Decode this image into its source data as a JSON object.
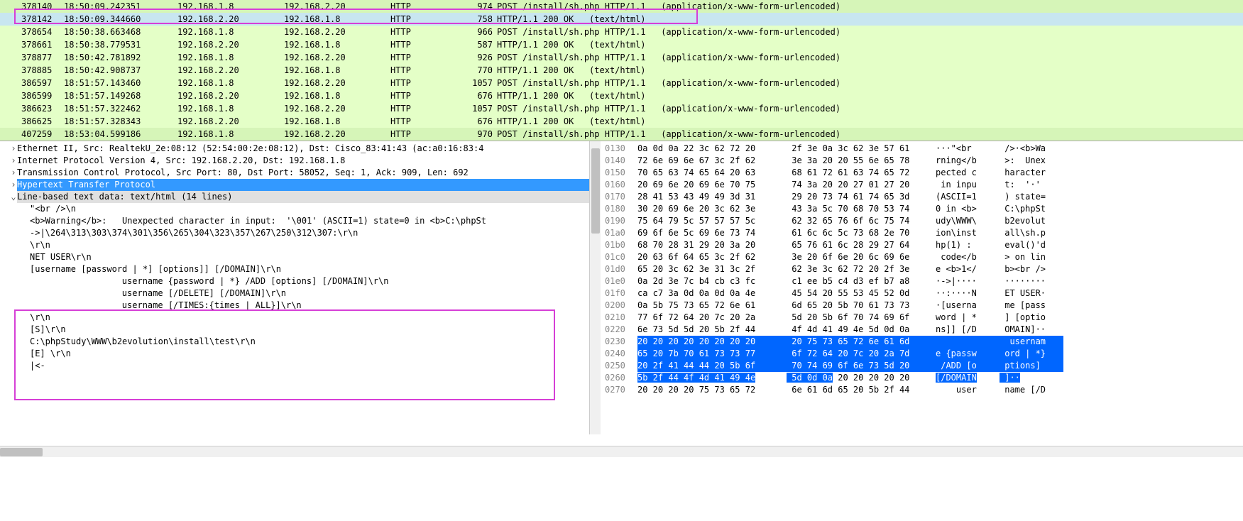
{
  "packets": [
    {
      "no": "378140",
      "time": "18:50:09.242351",
      "src": "192.168.1.8",
      "dst": "192.168.2.20",
      "proto": "HTTP",
      "len": "974",
      "info": "POST /install/sh.php HTTP/1.1   (application/x-www-form-urlencoded)",
      "sel": false,
      "alt": true
    },
    {
      "no": "378142",
      "time": "18:50:09.344660",
      "src": "192.168.2.20",
      "dst": "192.168.1.8",
      "proto": "HTTP",
      "len": "758",
      "info": "HTTP/1.1 200 OK   (text/html)",
      "sel": true,
      "alt": false
    },
    {
      "no": "378654",
      "time": "18:50:38.663468",
      "src": "192.168.1.8",
      "dst": "192.168.2.20",
      "proto": "HTTP",
      "len": "966",
      "info": "POST /install/sh.php HTTP/1.1   (application/x-www-form-urlencoded)",
      "sel": false,
      "alt": false
    },
    {
      "no": "378661",
      "time": "18:50:38.779531",
      "src": "192.168.2.20",
      "dst": "192.168.1.8",
      "proto": "HTTP",
      "len": "587",
      "info": "HTTP/1.1 200 OK   (text/html)",
      "sel": false,
      "alt": false
    },
    {
      "no": "378877",
      "time": "18:50:42.781892",
      "src": "192.168.1.8",
      "dst": "192.168.2.20",
      "proto": "HTTP",
      "len": "926",
      "info": "POST /install/sh.php HTTP/1.1   (application/x-www-form-urlencoded)",
      "sel": false,
      "alt": false
    },
    {
      "no": "378885",
      "time": "18:50:42.908737",
      "src": "192.168.2.20",
      "dst": "192.168.1.8",
      "proto": "HTTP",
      "len": "770",
      "info": "HTTP/1.1 200 OK   (text/html)",
      "sel": false,
      "alt": false
    },
    {
      "no": "386597",
      "time": "18:51:57.143460",
      "src": "192.168.1.8",
      "dst": "192.168.2.20",
      "proto": "HTTP",
      "len": "1057",
      "info": "POST /install/sh.php HTTP/1.1   (application/x-www-form-urlencoded)",
      "sel": false,
      "alt": false
    },
    {
      "no": "386599",
      "time": "18:51:57.149268",
      "src": "192.168.2.20",
      "dst": "192.168.1.8",
      "proto": "HTTP",
      "len": "676",
      "info": "HTTP/1.1 200 OK   (text/html)",
      "sel": false,
      "alt": false
    },
    {
      "no": "386623",
      "time": "18:51:57.322462",
      "src": "192.168.1.8",
      "dst": "192.168.2.20",
      "proto": "HTTP",
      "len": "1057",
      "info": "POST /install/sh.php HTTP/1.1   (application/x-www-form-urlencoded)",
      "sel": false,
      "alt": false
    },
    {
      "no": "386625",
      "time": "18:51:57.328343",
      "src": "192.168.2.20",
      "dst": "192.168.1.8",
      "proto": "HTTP",
      "len": "676",
      "info": "HTTP/1.1 200 OK   (text/html)",
      "sel": false,
      "alt": false
    },
    {
      "no": "407259",
      "time": "18:53:04.599186",
      "src": "192.168.1.8",
      "dst": "192.168.2.20",
      "proto": "HTTP",
      "len": "970",
      "info": "POST /install/sh.php HTTP/1.1   (application/x-www-form-urlencoded)",
      "sel": false,
      "alt": true
    }
  ],
  "tree": {
    "eth": "Ethernet II, Src: RealtekU_2e:08:12 (52:54:00:2e:08:12), Dst: Cisco_83:41:43 (ac:a0:16:83:4",
    "ip": "Internet Protocol Version 4, Src: 192.168.2.20, Dst: 192.168.1.8",
    "tcp": "Transmission Control Protocol, Src Port: 80, Dst Port: 58052, Seq: 1, Ack: 909, Len: 692",
    "http": "Hypertext Transfer Protocol",
    "line": "Line-based text data: text/html (14 lines)",
    "body": [
      "\"<br />\\n",
      "<b>Warning</b>:   Unexpected character in input:  '\\001' (ASCII=1) state=0 in <b>C:\\phpSt",
      "->|\\264\\313\\303\\374\\301\\356\\265\\304\\323\\357\\267\\250\\312\\307:\\r\\n",
      "\\r\\n",
      "NET USER\\r\\n",
      "[username [password | *] [options]] [/DOMAIN]\\r\\n",
      "        username {password | *} /ADD [options] [/DOMAIN]\\r\\n",
      "        username [/DELETE] [/DOMAIN]\\r\\n",
      "        username [/TIMES:{times | ALL}]\\r\\n",
      "\\r\\n",
      "[S]\\r\\n",
      "C:\\phpStudy\\WWW\\b2evolution\\install\\test\\r\\n",
      "[E] \\r\\n",
      "|<-"
    ]
  },
  "hex": [
    {
      "off": "0130",
      "b1": "0a 0d 0a 22 3c 62 72 20",
      "b2": " 2f 3e 0a 3c 62 3e 57 61",
      "a1": "···\"<br ",
      "a2": " />·<b>Wa"
    },
    {
      "off": "0140",
      "b1": "72 6e 69 6e 67 3c 2f 62",
      "b2": " 3e 3a 20 20 55 6e 65 78",
      "a1": "rning</b",
      "a2": " >:  Unex"
    },
    {
      "off": "0150",
      "b1": "70 65 63 74 65 64 20 63",
      "b2": " 68 61 72 61 63 74 65 72",
      "a1": "pected c",
      "a2": " haracter"
    },
    {
      "off": "0160",
      "b1": "20 69 6e 20 69 6e 70 75",
      "b2": " 74 3a 20 20 27 01 27 20",
      "a1": " in inpu",
      "a2": " t:  '·' "
    },
    {
      "off": "0170",
      "b1": "28 41 53 43 49 49 3d 31",
      "b2": " 29 20 73 74 61 74 65 3d",
      "a1": "(ASCII=1",
      "a2": " ) state="
    },
    {
      "off": "0180",
      "b1": "30 20 69 6e 20 3c 62 3e",
      "b2": " 43 3a 5c 70 68 70 53 74",
      "a1": "0 in <b>",
      "a2": " C:\\phpSt"
    },
    {
      "off": "0190",
      "b1": "75 64 79 5c 57 57 57 5c",
      "b2": " 62 32 65 76 6f 6c 75 74",
      "a1": "udy\\WWW\\",
      "a2": " b2evolut"
    },
    {
      "off": "01a0",
      "b1": "69 6f 6e 5c 69 6e 73 74",
      "b2": " 61 6c 6c 5c 73 68 2e 70",
      "a1": "ion\\inst",
      "a2": " all\\sh.p"
    },
    {
      "off": "01b0",
      "b1": "68 70 28 31 29 20 3a 20",
      "b2": " 65 76 61 6c 28 29 27 64",
      "a1": "hp(1) : ",
      "a2": " eval()'d"
    },
    {
      "off": "01c0",
      "b1": "20 63 6f 64 65 3c 2f 62",
      "b2": " 3e 20 6f 6e 20 6c 69 6e",
      "a1": " code</b",
      "a2": " > on lin"
    },
    {
      "off": "01d0",
      "b1": "65 20 3c 62 3e 31 3c 2f",
      "b2": " 62 3e 3c 62 72 20 2f 3e",
      "a1": "e <b>1</",
      "a2": " b><br />"
    },
    {
      "off": "01e0",
      "b1": "0a 2d 3e 7c b4 cb c3 fc",
      "b2": " c1 ee b5 c4 d3 ef b7 a8",
      "a1": "·->|····",
      "a2": " ········"
    },
    {
      "off": "01f0",
      "b1": "ca c7 3a 0d 0a 0d 0a 4e",
      "b2": " 45 54 20 55 53 45 52 0d",
      "a1": "··:····N",
      "a2": " ET USER·"
    },
    {
      "off": "0200",
      "b1": "0a 5b 75 73 65 72 6e 61",
      "b2": " 6d 65 20 5b 70 61 73 73",
      "a1": "·[userna",
      "a2": " me [pass"
    },
    {
      "off": "0210",
      "b1": "77 6f 72 64 20 7c 20 2a",
      "b2": " 5d 20 5b 6f 70 74 69 6f",
      "a1": "word | *",
      "a2": " ] [optio"
    },
    {
      "off": "0220",
      "b1": "6e 73 5d 5d 20 5b 2f 44",
      "b2": " 4f 4d 41 49 4e 5d 0d 0a",
      "a1": "ns]] [/D",
      "a2": " OMAIN]··"
    },
    {
      "off": "0230",
      "b1": "20 20 20 20 20 20 20 20",
      "b2": " 20 75 73 65 72 6e 61 6d",
      "a1": "        ",
      "a2": "  usernam",
      "hl": true
    },
    {
      "off": "0240",
      "b1": "65 20 7b 70 61 73 73 77",
      "b2": " 6f 72 64 20 7c 20 2a 7d",
      "a1": "e {passw",
      "a2": " ord | *}",
      "hl": true
    },
    {
      "off": "0250",
      "b1": "20 2f 41 44 44 20 5b 6f",
      "b2": " 70 74 69 6f 6e 73 5d 20",
      "a1": " /ADD [o",
      "a2": " ptions] ",
      "hl": true
    },
    {
      "off": "0260",
      "b1": "5b 2f 44 4f 4d 41 49 4e",
      "b2": " 5d 0d 0a",
      "b2x": " 20 20 20 20 20",
      "a1": "[/DOMAIN",
      "a2": " ]··",
      "a2x": "     ",
      "hl": true,
      "partial": true
    },
    {
      "off": "0270",
      "b1": "20 20 20 20 75 73 65 72",
      "b2": " 6e 61 6d 65 20 5b 2f 44",
      "a1": "    user",
      "a2": " name [/D"
    }
  ]
}
